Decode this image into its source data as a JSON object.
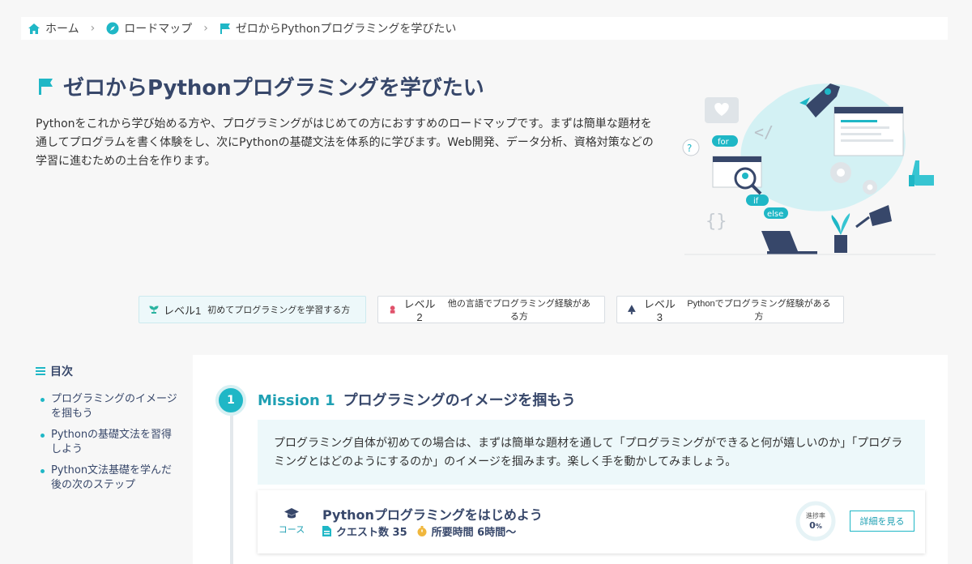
{
  "breadcrumb": {
    "home": "ホーム",
    "roadmap": "ロードマップ",
    "current": "ゼロからPythonプログラミングを学びたい"
  },
  "hero": {
    "title": "ゼロからPythonプログラミングを学びたい",
    "description": "Pythonをこれから学び始める方や、プログラミングがはじめての方におすすめのロードマップです。まずは簡単な題材を通してプログラムを書く体験をし、次にPythonの基礎文法を体系的に学びます。Web開発、データ分析、資格対策などの学習に進むための土台を作ります。"
  },
  "illustration": {
    "tags": [
      "for",
      "if",
      "else"
    ],
    "symbols": [
      "</",
      "{}",
      "?"
    ]
  },
  "levels": [
    {
      "label": "レベル1",
      "desc": "初めてプログラミングを学習する方",
      "icon": "sprout-icon",
      "active": true
    },
    {
      "label": "レベル2",
      "desc": "他の言語でプログラミング経験がある方",
      "icon": "flower-icon",
      "active": false
    },
    {
      "label": "レベル3",
      "desc": "Pythonでプログラミング経験がある方",
      "icon": "tree-icon",
      "active": false
    }
  ],
  "toc": {
    "title": "目次",
    "items": [
      "プログラミングのイメージを掴もう",
      "Pythonの基礎文法を習得しよう",
      "Python文法基礎を学んだ後の次のステップ"
    ]
  },
  "mission": {
    "number": "1",
    "label": "Mission 1",
    "title": "プログラミングのイメージを掴もう",
    "description": "プログラミング自体が初めての場合は、まずは簡単な題材を通して「プログラミングができると何が嬉しいのか」「プログラミングとはどのようにするのか」のイメージを掴みます。楽しく手を動かしてみましょう。"
  },
  "course": {
    "type": "コース",
    "title": "Pythonプログラミングをはじめよう",
    "quest_count": "クエスト数 35",
    "duration": "所要時間 6時間〜",
    "progress_label": "進捗率",
    "progress_value": "0",
    "progress_unit": "%",
    "detail_button": "詳細を見る"
  },
  "colors": {
    "accent": "#1fb7c6",
    "navy": "#37476a",
    "light_accent": "#edf8fa"
  }
}
